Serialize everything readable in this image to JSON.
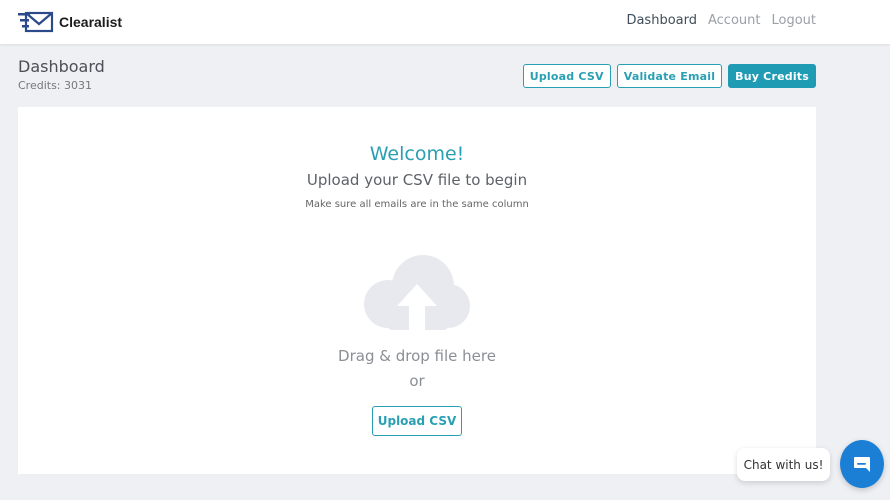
{
  "brand": {
    "name": "Clearalist",
    "logo_icon": "envelope-logo-icon",
    "logo_color": "#2a4a8a"
  },
  "nav": {
    "dashboard": "Dashboard",
    "account": "Account",
    "logout": "Logout",
    "active_color": "#3f4e5a",
    "inactive_color": "#9aa0a6"
  },
  "header": {
    "title": "Dashboard",
    "credits": "Credits: 3031"
  },
  "actions": {
    "upload_csv": "Upload CSV",
    "validate_email": "Validate Email",
    "buy_credits": "Buy Credits",
    "accent_color": "#1f9bb3"
  },
  "main": {
    "welcome": "Welcome!",
    "subtitle": "Upload your CSV file to begin",
    "hint": "Make sure all emails are in the same column",
    "upload_icon": "cloud-upload-icon",
    "drag_text": "Drag & drop file here",
    "or_text": "or",
    "upload_button": "Upload CSV"
  },
  "chat": {
    "label": "Chat with us!",
    "icon": "chat-icon",
    "button_color": "#1b7fd6"
  }
}
